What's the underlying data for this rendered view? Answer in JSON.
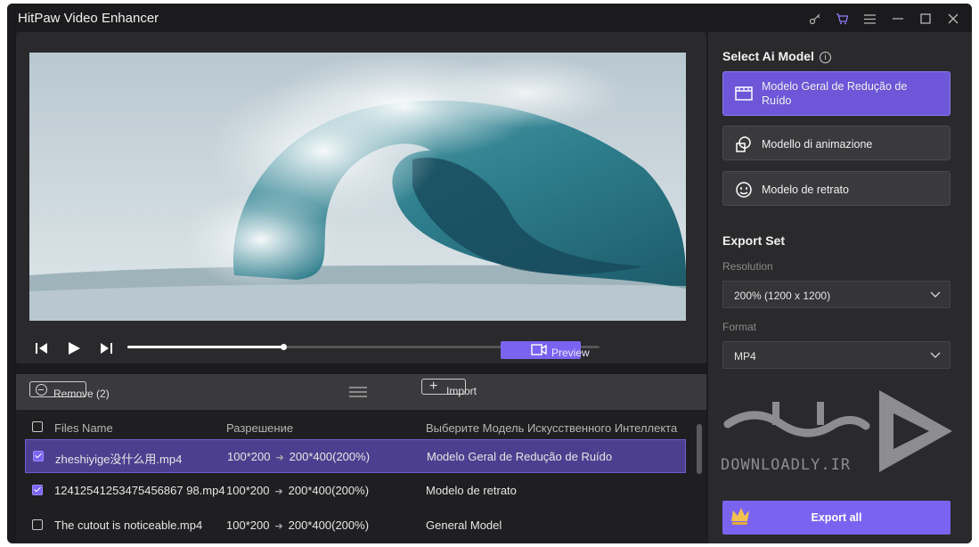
{
  "window": {
    "title": "HitPaw Video Enhancer"
  },
  "titlebar_icons": [
    "key-icon",
    "cart-icon",
    "menu-icon",
    "minimize-icon",
    "maximize-icon",
    "close-icon"
  ],
  "player": {
    "progress_percent": 33,
    "preview_label": "Preview"
  },
  "file_toolbar": {
    "remove_label": "Remove (2)",
    "import_label": "Import"
  },
  "table": {
    "headers": [
      "Files Name",
      "Разрешение",
      "Выберите Модель Искусственного Интеллекта"
    ],
    "rows": [
      {
        "checked": true,
        "name": "zheshiyige没什么用.mp4",
        "from": "100*200",
        "to": "200*400(200%)",
        "model": "Modelo Geral de Redução de Ruído",
        "selected": true
      },
      {
        "checked": true,
        "name": "12412541253475456867 98.mp4",
        "from": "100*200",
        "to": "200*400(200%)",
        "model": "Modelo de retrato",
        "selected": false
      },
      {
        "checked": false,
        "name": "The cutout is noticeable.mp4",
        "from": "100*200",
        "to": "200*400(200%)",
        "model": "General Model",
        "selected": false
      }
    ]
  },
  "ai_model": {
    "title": "Select Ai Model",
    "models": [
      {
        "label": "Modelo Geral de Redução de Ruído",
        "icon": "film-icon",
        "active": true
      },
      {
        "label": "Modello di animazione",
        "icon": "animation-icon",
        "active": false
      },
      {
        "label": "Modelo de retrato",
        "icon": "face-icon",
        "active": false
      }
    ]
  },
  "export_set": {
    "title": "Export Set",
    "resolution_label": "Resolution",
    "resolution_value": "200% (1200 x 1200)",
    "format_label": "Format",
    "format_value": "MP4",
    "watermark_text": "DOWNLOADLY.IR",
    "export_label": "Export all"
  },
  "colors": {
    "accent": "#7b63f2",
    "panel": "#2a2a2c",
    "background": "#1b1b1d"
  }
}
